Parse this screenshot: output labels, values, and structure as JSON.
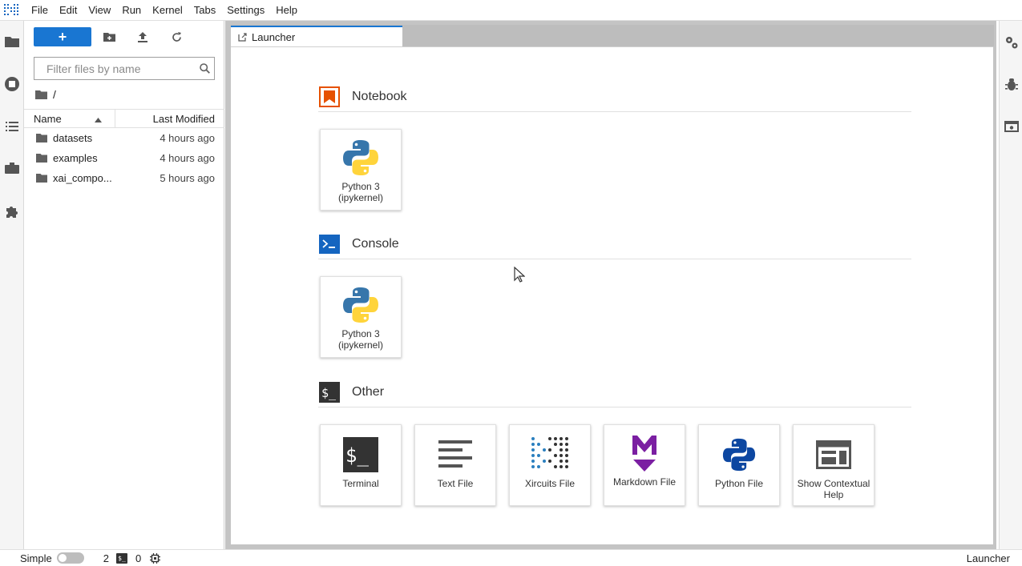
{
  "menu": [
    "File",
    "Edit",
    "View",
    "Run",
    "Kernel",
    "Tabs",
    "Settings",
    "Help"
  ],
  "left_bar_icons": [
    "folder-icon",
    "running-icon",
    "toc-icon",
    "commands-icon",
    "extension-icon"
  ],
  "file_browser": {
    "new_label": "+",
    "filter_placeholder": "Filter files by name",
    "breadcrumb": "/",
    "columns": {
      "name": "Name",
      "modified": "Last Modified"
    },
    "files": [
      {
        "name": "datasets",
        "modified": "4 hours ago"
      },
      {
        "name": "examples",
        "modified": "4 hours ago"
      },
      {
        "name": "xai_compo...",
        "modified": "5 hours ago"
      }
    ]
  },
  "tab": {
    "label": "Launcher"
  },
  "launcher": {
    "notebook": {
      "title": "Notebook",
      "cards": [
        {
          "label": "Python 3 (ipykernel)"
        }
      ]
    },
    "console": {
      "title": "Console",
      "cards": [
        {
          "label": "Python 3 (ipykernel)"
        }
      ]
    },
    "other": {
      "title": "Other",
      "cards": [
        {
          "label": "Terminal"
        },
        {
          "label": "Text File"
        },
        {
          "label": "Xircuits File"
        },
        {
          "label": "Markdown File"
        },
        {
          "label": "Python File"
        },
        {
          "label": "Show Contextual Help"
        }
      ]
    }
  },
  "status": {
    "mode_label": "Simple",
    "terminals_count": "2",
    "terminal_badge": "$_",
    "kernels_count": "0",
    "right_label": "Launcher"
  },
  "colors": {
    "accent": "#1976d2",
    "notebook_orange": "#e65100",
    "console_blue": "#1565c0",
    "markdown_purple": "#7b1fa2"
  }
}
